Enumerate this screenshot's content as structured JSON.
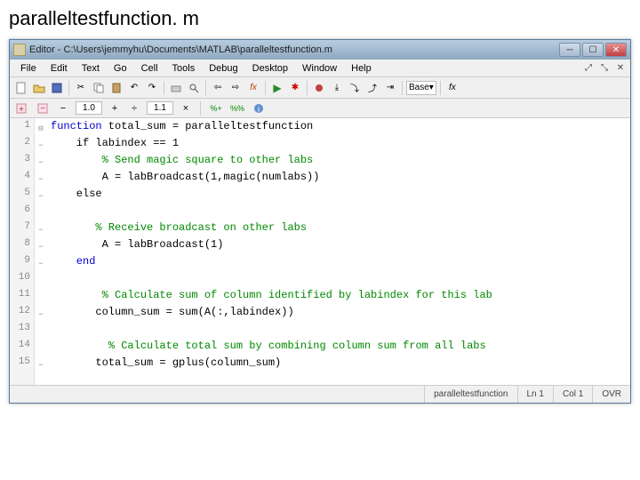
{
  "pageTitle": "paralleltestfunction. m",
  "titlebar": {
    "text": "Editor - C:\\Users\\jemmyhu\\Documents\\MATLAB\\paralleltestfunction.m"
  },
  "menu": {
    "file": "File",
    "edit": "Edit",
    "text": "Text",
    "go": "Go",
    "cell": "Cell",
    "tools": "Tools",
    "debug": "Debug",
    "desktop": "Desktop",
    "window": "Window",
    "help": "Help"
  },
  "toolbar": {
    "base": "Base",
    "fx": "fx"
  },
  "secondbar": {
    "val1": "1.0",
    "val2": "1.1",
    "minus": "−",
    "plus": "+",
    "div": "÷",
    "mul": "×"
  },
  "code": {
    "lines": [
      {
        "n": "1",
        "fold": "⊟",
        "kw1": "function",
        "rest": " total_sum = paralleltestfunction"
      },
      {
        "n": "2",
        "fold": "−",
        "plain": "    if labindex == 1"
      },
      {
        "n": "3",
        "fold": "−",
        "cmt": "        % Send magic square to other labs"
      },
      {
        "n": "4",
        "fold": "−",
        "plain": "        A = labBroadcast(1,magic(numlabs))"
      },
      {
        "n": "5",
        "fold": "−",
        "plain": "    else"
      },
      {
        "n": "6",
        "fold": "",
        "plain": ""
      },
      {
        "n": "7",
        "fold": "−",
        "cmt": "       % Receive broadcast on other labs"
      },
      {
        "n": "8",
        "fold": "−",
        "plain": "        A = labBroadcast(1)"
      },
      {
        "n": "9",
        "fold": "−",
        "kw1": "    end",
        "rest": ""
      },
      {
        "n": "10",
        "fold": "",
        "plain": ""
      },
      {
        "n": "11",
        "fold": "",
        "cmt": "        % Calculate sum of column identified by labindex for this lab"
      },
      {
        "n": "12",
        "fold": "−",
        "plain": "       column_sum = sum(A(:,labindex))"
      },
      {
        "n": "13",
        "fold": "",
        "plain": ""
      },
      {
        "n": "14",
        "fold": "",
        "cmt": "         % Calculate total sum by combining column sum from all labs"
      },
      {
        "n": "15",
        "fold": "−",
        "plain": "       total_sum = gplus(column_sum)"
      }
    ]
  },
  "status": {
    "func": "paralleltestfunction",
    "ln": "Ln  1",
    "col": "Col  1",
    "ovr": "OVR"
  }
}
